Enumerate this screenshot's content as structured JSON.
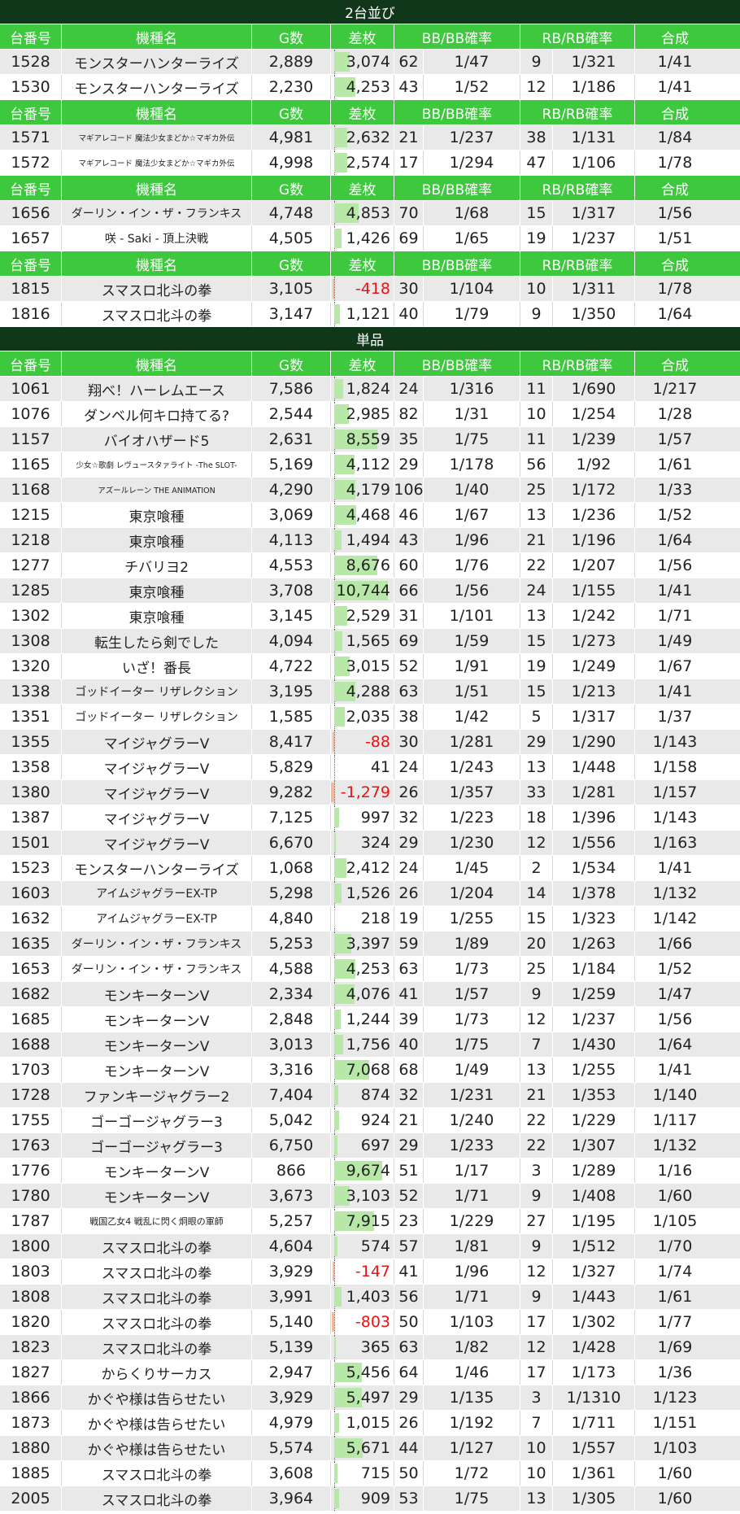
{
  "headers": [
    "台番号",
    "機種名",
    "G数",
    "差枚",
    "BB/BB確率",
    "RB/RB確率",
    "合成"
  ],
  "max_diff": 10744,
  "sections": [
    {
      "title": "2台並び",
      "groups": [
        [
          {
            "no": "1528",
            "name": "モンスターハンターライズ",
            "g": "2,889",
            "diff": 3074,
            "diff_text": "3,074",
            "bb": "62",
            "bbp": "1/47",
            "rb": "9",
            "rbp": "1/321",
            "gou": "1/41"
          },
          {
            "no": "1530",
            "name": "モンスターハンターライズ",
            "g": "2,230",
            "diff": 4253,
            "diff_text": "4,253",
            "bb": "43",
            "bbp": "1/52",
            "rb": "12",
            "rbp": "1/186",
            "gou": "1/41"
          }
        ],
        [
          {
            "no": "1571",
            "name": "マギアレコード 魔法少女まどか☆マギカ外伝",
            "g": "4,981",
            "diff": 2632,
            "diff_text": "2,632",
            "bb": "21",
            "bbp": "1/237",
            "rb": "38",
            "rbp": "1/131",
            "gou": "1/84"
          },
          {
            "no": "1572",
            "name": "マギアレコード 魔法少女まどか☆マギカ外伝",
            "g": "4,998",
            "diff": 2574,
            "diff_text": "2,574",
            "bb": "17",
            "bbp": "1/294",
            "rb": "47",
            "rbp": "1/106",
            "gou": "1/78"
          }
        ],
        [
          {
            "no": "1656",
            "name": "ダーリン・イン・ザ・フランキス",
            "g": "4,748",
            "diff": 4853,
            "diff_text": "4,853",
            "bb": "70",
            "bbp": "1/68",
            "rb": "15",
            "rbp": "1/317",
            "gou": "1/56"
          },
          {
            "no": "1657",
            "name": "咲 - Saki - 頂上決戦",
            "g": "4,505",
            "diff": 1426,
            "diff_text": "1,426",
            "bb": "69",
            "bbp": "1/65",
            "rb": "19",
            "rbp": "1/237",
            "gou": "1/51"
          }
        ],
        [
          {
            "no": "1815",
            "name": "スマスロ北斗の拳",
            "g": "3,105",
            "diff": -418,
            "diff_text": "-418",
            "bb": "30",
            "bbp": "1/104",
            "rb": "10",
            "rbp": "1/311",
            "gou": "1/78"
          },
          {
            "no": "1816",
            "name": "スマスロ北斗の拳",
            "g": "3,147",
            "diff": 1121,
            "diff_text": "1,121",
            "bb": "40",
            "bbp": "1/79",
            "rb": "9",
            "rbp": "1/350",
            "gou": "1/64"
          }
        ]
      ]
    },
    {
      "title": "単品",
      "groups": [
        [
          {
            "no": "1061",
            "name": "翔べ！ハーレムエース",
            "g": "7,586",
            "diff": 1824,
            "diff_text": "1,824",
            "bb": "24",
            "bbp": "1/316",
            "rb": "11",
            "rbp": "1/690",
            "gou": "1/217"
          },
          {
            "no": "1076",
            "name": "ダンベル何キロ持てる?",
            "g": "2,544",
            "diff": 2985,
            "diff_text": "2,985",
            "bb": "82",
            "bbp": "1/31",
            "rb": "10",
            "rbp": "1/254",
            "gou": "1/28"
          },
          {
            "no": "1157",
            "name": "バイオハザード5",
            "g": "2,631",
            "diff": 8559,
            "diff_text": "8,559",
            "bb": "35",
            "bbp": "1/75",
            "rb": "11",
            "rbp": "1/239",
            "gou": "1/57"
          },
          {
            "no": "1165",
            "name": "少女☆歌劇 レヴュースタァライト -The SLOT-",
            "g": "5,169",
            "diff": 4112,
            "diff_text": "4,112",
            "bb": "29",
            "bbp": "1/178",
            "rb": "56",
            "rbp": "1/92",
            "gou": "1/61"
          },
          {
            "no": "1168",
            "name": "アズールレーン THE ANIMATION",
            "g": "4,290",
            "diff": 4179,
            "diff_text": "4,179",
            "bb": "106",
            "bbp": "1/40",
            "rb": "25",
            "rbp": "1/172",
            "gou": "1/33"
          },
          {
            "no": "1215",
            "name": "東京喰種",
            "g": "3,069",
            "diff": 4468,
            "diff_text": "4,468",
            "bb": "46",
            "bbp": "1/67",
            "rb": "13",
            "rbp": "1/236",
            "gou": "1/52"
          },
          {
            "no": "1218",
            "name": "東京喰種",
            "g": "4,113",
            "diff": 1494,
            "diff_text": "1,494",
            "bb": "43",
            "bbp": "1/96",
            "rb": "21",
            "rbp": "1/196",
            "gou": "1/64"
          },
          {
            "no": "1277",
            "name": "チバリヨ2",
            "g": "4,553",
            "diff": 8676,
            "diff_text": "8,676",
            "bb": "60",
            "bbp": "1/76",
            "rb": "22",
            "rbp": "1/207",
            "gou": "1/56"
          },
          {
            "no": "1285",
            "name": "東京喰種",
            "g": "3,708",
            "diff": 10744,
            "diff_text": "10,744",
            "bb": "66",
            "bbp": "1/56",
            "rb": "24",
            "rbp": "1/155",
            "gou": "1/41"
          },
          {
            "no": "1302",
            "name": "東京喰種",
            "g": "3,145",
            "diff": 2529,
            "diff_text": "2,529",
            "bb": "31",
            "bbp": "1/101",
            "rb": "13",
            "rbp": "1/242",
            "gou": "1/71"
          },
          {
            "no": "1308",
            "name": "転生したら剣でした",
            "g": "4,094",
            "diff": 1565,
            "diff_text": "1,565",
            "bb": "69",
            "bbp": "1/59",
            "rb": "15",
            "rbp": "1/273",
            "gou": "1/49"
          },
          {
            "no": "1320",
            "name": "いざ！番長",
            "g": "4,722",
            "diff": 3015,
            "diff_text": "3,015",
            "bb": "52",
            "bbp": "1/91",
            "rb": "19",
            "rbp": "1/249",
            "gou": "1/67"
          },
          {
            "no": "1338",
            "name": "ゴッドイーター リザレクション",
            "g": "3,195",
            "diff": 4288,
            "diff_text": "4,288",
            "bb": "63",
            "bbp": "1/51",
            "rb": "15",
            "rbp": "1/213",
            "gou": "1/41"
          },
          {
            "no": "1351",
            "name": "ゴッドイーター リザレクション",
            "g": "1,585",
            "diff": 2035,
            "diff_text": "2,035",
            "bb": "38",
            "bbp": "1/42",
            "rb": "5",
            "rbp": "1/317",
            "gou": "1/37"
          },
          {
            "no": "1355",
            "name": "マイジャグラーV",
            "g": "8,417",
            "diff": -88,
            "diff_text": "-88",
            "bb": "30",
            "bbp": "1/281",
            "rb": "29",
            "rbp": "1/290",
            "gou": "1/143"
          },
          {
            "no": "1358",
            "name": "マイジャグラーV",
            "g": "5,829",
            "diff": 41,
            "diff_text": "41",
            "bb": "24",
            "bbp": "1/243",
            "rb": "13",
            "rbp": "1/448",
            "gou": "1/158"
          },
          {
            "no": "1380",
            "name": "マイジャグラーV",
            "g": "9,282",
            "diff": -1279,
            "diff_text": "-1,279",
            "bb": "26",
            "bbp": "1/357",
            "rb": "33",
            "rbp": "1/281",
            "gou": "1/157"
          },
          {
            "no": "1387",
            "name": "マイジャグラーV",
            "g": "7,125",
            "diff": 997,
            "diff_text": "997",
            "bb": "32",
            "bbp": "1/223",
            "rb": "18",
            "rbp": "1/396",
            "gou": "1/143"
          },
          {
            "no": "1501",
            "name": "マイジャグラーV",
            "g": "6,670",
            "diff": 324,
            "diff_text": "324",
            "bb": "29",
            "bbp": "1/230",
            "rb": "12",
            "rbp": "1/556",
            "gou": "1/163"
          },
          {
            "no": "1523",
            "name": "モンスターハンターライズ",
            "g": "1,068",
            "diff": 2412,
            "diff_text": "2,412",
            "bb": "24",
            "bbp": "1/45",
            "rb": "2",
            "rbp": "1/534",
            "gou": "1/41"
          },
          {
            "no": "1603",
            "name": "アイムジャグラーEX-TP",
            "g": "5,298",
            "diff": 1526,
            "diff_text": "1,526",
            "bb": "26",
            "bbp": "1/204",
            "rb": "14",
            "rbp": "1/378",
            "gou": "1/132"
          },
          {
            "no": "1632",
            "name": "アイムジャグラーEX-TP",
            "g": "4,840",
            "diff": 218,
            "diff_text": "218",
            "bb": "19",
            "bbp": "1/255",
            "rb": "15",
            "rbp": "1/323",
            "gou": "1/142"
          },
          {
            "no": "1635",
            "name": "ダーリン・イン・ザ・フランキス",
            "g": "5,253",
            "diff": 3397,
            "diff_text": "3,397",
            "bb": "59",
            "bbp": "1/89",
            "rb": "20",
            "rbp": "1/263",
            "gou": "1/66"
          },
          {
            "no": "1653",
            "name": "ダーリン・イン・ザ・フランキス",
            "g": "4,588",
            "diff": 4253,
            "diff_text": "4,253",
            "bb": "63",
            "bbp": "1/73",
            "rb": "25",
            "rbp": "1/184",
            "gou": "1/52"
          },
          {
            "no": "1682",
            "name": "モンキーターンV",
            "g": "2,334",
            "diff": 4076,
            "diff_text": "4,076",
            "bb": "41",
            "bbp": "1/57",
            "rb": "9",
            "rbp": "1/259",
            "gou": "1/47"
          },
          {
            "no": "1685",
            "name": "モンキーターンV",
            "g": "2,848",
            "diff": 1244,
            "diff_text": "1,244",
            "bb": "39",
            "bbp": "1/73",
            "rb": "12",
            "rbp": "1/237",
            "gou": "1/56"
          },
          {
            "no": "1688",
            "name": "モンキーターンV",
            "g": "3,013",
            "diff": 1756,
            "diff_text": "1,756",
            "bb": "40",
            "bbp": "1/75",
            "rb": "7",
            "rbp": "1/430",
            "gou": "1/64"
          },
          {
            "no": "1703",
            "name": "モンキーターンV",
            "g": "3,316",
            "diff": 7068,
            "diff_text": "7,068",
            "bb": "68",
            "bbp": "1/49",
            "rb": "13",
            "rbp": "1/255",
            "gou": "1/41"
          },
          {
            "no": "1728",
            "name": "ファンキージャグラー2",
            "g": "7,404",
            "diff": 874,
            "diff_text": "874",
            "bb": "32",
            "bbp": "1/231",
            "rb": "21",
            "rbp": "1/353",
            "gou": "1/140"
          },
          {
            "no": "1755",
            "name": "ゴーゴージャグラー3",
            "g": "5,042",
            "diff": 924,
            "diff_text": "924",
            "bb": "21",
            "bbp": "1/240",
            "rb": "22",
            "rbp": "1/229",
            "gou": "1/117"
          },
          {
            "no": "1763",
            "name": "ゴーゴージャグラー3",
            "g": "6,750",
            "diff": 697,
            "diff_text": "697",
            "bb": "29",
            "bbp": "1/233",
            "rb": "22",
            "rbp": "1/307",
            "gou": "1/132"
          },
          {
            "no": "1776",
            "name": "モンキーターンV",
            "g": "866",
            "diff": 9674,
            "diff_text": "9,674",
            "bb": "51",
            "bbp": "1/17",
            "rb": "3",
            "rbp": "1/289",
            "gou": "1/16"
          },
          {
            "no": "1780",
            "name": "モンキーターンV",
            "g": "3,673",
            "diff": 3103,
            "diff_text": "3,103",
            "bb": "52",
            "bbp": "1/71",
            "rb": "9",
            "rbp": "1/408",
            "gou": "1/60"
          },
          {
            "no": "1787",
            "name": "戦国乙女4 戦乱に閃く炯眼の軍師",
            "g": "5,257",
            "diff": 7915,
            "diff_text": "7,915",
            "bb": "23",
            "bbp": "1/229",
            "rb": "27",
            "rbp": "1/195",
            "gou": "1/105"
          },
          {
            "no": "1800",
            "name": "スマスロ北斗の拳",
            "g": "4,604",
            "diff": 574,
            "diff_text": "574",
            "bb": "57",
            "bbp": "1/81",
            "rb": "9",
            "rbp": "1/512",
            "gou": "1/70"
          },
          {
            "no": "1803",
            "name": "スマスロ北斗の拳",
            "g": "3,929",
            "diff": -147,
            "diff_text": "-147",
            "bb": "41",
            "bbp": "1/96",
            "rb": "12",
            "rbp": "1/327",
            "gou": "1/74"
          },
          {
            "no": "1808",
            "name": "スマスロ北斗の拳",
            "g": "3,991",
            "diff": 1403,
            "diff_text": "1,403",
            "bb": "56",
            "bbp": "1/71",
            "rb": "9",
            "rbp": "1/443",
            "gou": "1/61"
          },
          {
            "no": "1820",
            "name": "スマスロ北斗の拳",
            "g": "5,140",
            "diff": -803,
            "diff_text": "-803",
            "bb": "50",
            "bbp": "1/103",
            "rb": "17",
            "rbp": "1/302",
            "gou": "1/77"
          },
          {
            "no": "1823",
            "name": "スマスロ北斗の拳",
            "g": "5,139",
            "diff": 365,
            "diff_text": "365",
            "bb": "63",
            "bbp": "1/82",
            "rb": "12",
            "rbp": "1/428",
            "gou": "1/69"
          },
          {
            "no": "1827",
            "name": "からくりサーカス",
            "g": "2,947",
            "diff": 5456,
            "diff_text": "5,456",
            "bb": "64",
            "bbp": "1/46",
            "rb": "17",
            "rbp": "1/173",
            "gou": "1/36"
          },
          {
            "no": "1866",
            "name": "かぐや様は告らせたい",
            "g": "3,929",
            "diff": 5497,
            "diff_text": "5,497",
            "bb": "29",
            "bbp": "1/135",
            "rb": "3",
            "rbp": "1/1310",
            "gou": "1/123"
          },
          {
            "no": "1873",
            "name": "かぐや様は告らせたい",
            "g": "4,979",
            "diff": 1015,
            "diff_text": "1,015",
            "bb": "26",
            "bbp": "1/192",
            "rb": "7",
            "rbp": "1/711",
            "gou": "1/151"
          },
          {
            "no": "1880",
            "name": "かぐや様は告らせたい",
            "g": "5,574",
            "diff": 5671,
            "diff_text": "5,671",
            "bb": "44",
            "bbp": "1/127",
            "rb": "10",
            "rbp": "1/557",
            "gou": "1/103"
          },
          {
            "no": "1885",
            "name": "スマスロ北斗の拳",
            "g": "3,608",
            "diff": 715,
            "diff_text": "715",
            "bb": "50",
            "bbp": "1/72",
            "rb": "10",
            "rbp": "1/361",
            "gou": "1/60"
          },
          {
            "no": "2005",
            "name": "スマスロ北斗の拳",
            "g": "3,964",
            "diff": 909,
            "diff_text": "909",
            "bb": "53",
            "bbp": "1/75",
            "rb": "13",
            "rbp": "1/305",
            "gou": "1/60"
          }
        ]
      ]
    }
  ],
  "colors": {
    "section_bg": "#11371a",
    "header_bg": "#3ec83e",
    "row_alt": "#e9e9e9",
    "pos_bar": "#b7e8a8",
    "neg_bar": "#f6b899",
    "neg_text": "#ee1111"
  }
}
